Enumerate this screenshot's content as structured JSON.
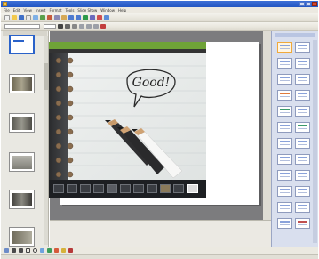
{
  "window": {
    "title": ""
  },
  "menu": {
    "items": [
      "File",
      "Edit",
      "View",
      "Insert",
      "Format",
      "Tools",
      "Slide Show",
      "Window",
      "Help"
    ]
  },
  "viewer": {
    "title": "",
    "note_text": "Good!"
  },
  "status": {
    "text": ""
  },
  "colors": {
    "titlebar": "#2356c3",
    "viewer_header": "#6fa338",
    "workspace": "#7c7c7e",
    "task_pane": "#d9dfee"
  }
}
